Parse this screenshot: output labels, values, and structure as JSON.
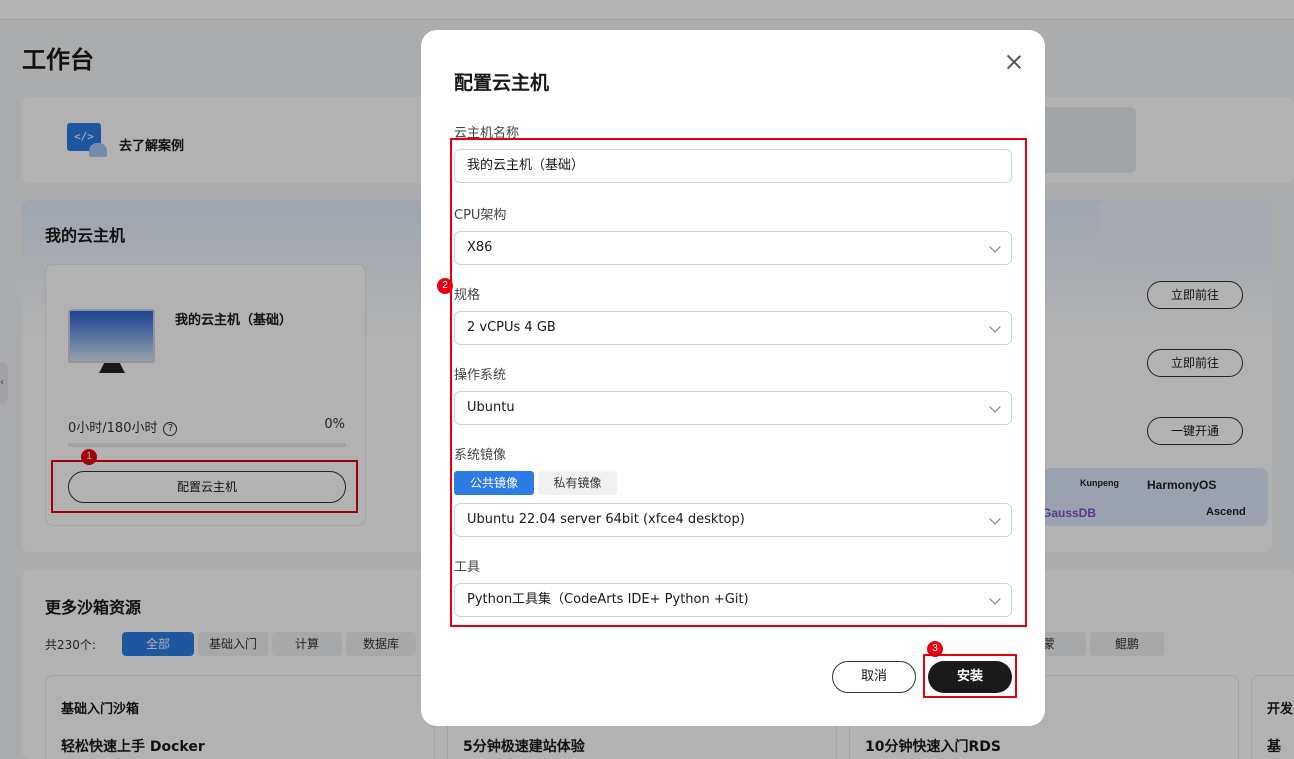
{
  "page": {
    "title": "工作台"
  },
  "case": {
    "label": "去了解案例",
    "icon_text": "</>"
  },
  "vm": {
    "section_title": "我的云主机",
    "card_name": "我的云主机（基础）",
    "usage_text": "0小时/180小时",
    "usage_percent_text": "0%",
    "usage_fraction": 0,
    "config_button": "配置云主机",
    "right_buttons": [
      "立即前往",
      "立即前往",
      "一键开通"
    ],
    "logos": [
      "Kunpeng",
      "HarmonyOS",
      "GaussDB",
      "Ascend"
    ]
  },
  "more": {
    "title": "更多沙箱资源",
    "count_label": "共230个:",
    "chips": [
      "全部",
      "基础入门",
      "计算",
      "数据库",
      "蒙",
      "鲲鹏"
    ],
    "cards": [
      {
        "title": "基础入门沙箱",
        "item": "轻松快速上手 Docker"
      },
      {
        "title": "",
        "item": "5分钟极速建站体验"
      },
      {
        "title": "",
        "item": "10分钟快速入门RDS"
      },
      {
        "title": "开发",
        "item": "基于"
      }
    ]
  },
  "annotations": {
    "badge1": "1",
    "badge2": "2",
    "badge3": "3"
  },
  "modal": {
    "title": "配置云主机",
    "name_label": "云主机名称",
    "name_value": "我的云主机（基础）",
    "cpu_label": "CPU架构",
    "cpu_value": "X86",
    "spec_label": "规格",
    "spec_value": "2 vCPUs 4 GB",
    "os_label": "操作系统",
    "os_value": "Ubuntu",
    "image_label": "系统镜像",
    "image_tabs": [
      "公共镜像",
      "私有镜像"
    ],
    "image_value": "Ubuntu 22.04 server 64bit (xfce4 desktop)",
    "tool_label": "工具",
    "tool_value": "Python工具集（CodeArts IDE+ Python +Git)",
    "cancel": "取消",
    "install": "安装"
  },
  "colors": {
    "accent": "#2d7be5",
    "highlight": "#e60012",
    "primary_button": "#1a1a1a"
  }
}
